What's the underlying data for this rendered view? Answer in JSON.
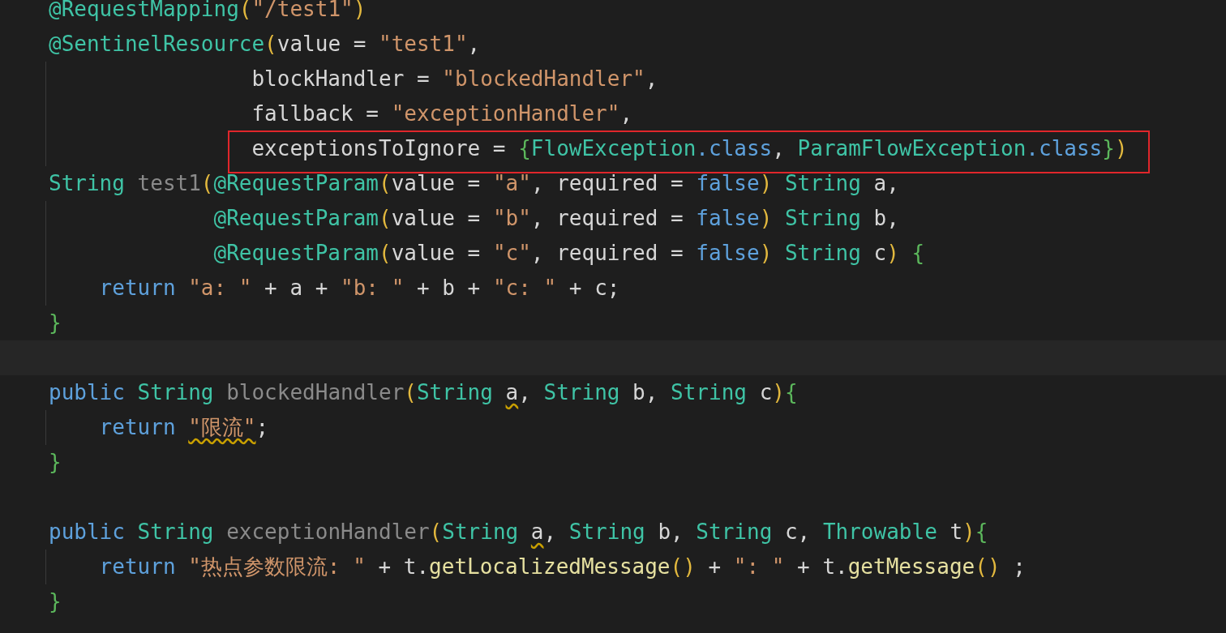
{
  "editor": {
    "lines": [
      {
        "kind": "code",
        "tokens": [
          {
            "kind": "ann",
            "text": "@RequestMapping"
          },
          {
            "kind": "paren",
            "text": "("
          },
          {
            "kind": "str",
            "text": "\"/test1\""
          },
          {
            "kind": "paren",
            "text": ")"
          }
        ]
      },
      {
        "kind": "code",
        "tokens": [
          {
            "kind": "ann",
            "text": "@SentinelResource"
          },
          {
            "kind": "paren",
            "text": "("
          },
          {
            "kind": "plain",
            "text": "value = "
          },
          {
            "kind": "str",
            "text": "\"test1\""
          },
          {
            "kind": "plain",
            "text": ","
          }
        ]
      },
      {
        "kind": "code",
        "guide": true,
        "tokens": [
          {
            "kind": "plain",
            "text": "                blockHandler = "
          },
          {
            "kind": "str",
            "text": "\"blockedHandler\""
          },
          {
            "kind": "plain",
            "text": ","
          }
        ]
      },
      {
        "kind": "code",
        "guide": true,
        "tokens": [
          {
            "kind": "plain",
            "text": "                fallback = "
          },
          {
            "kind": "str",
            "text": "\"exceptionHandler\""
          },
          {
            "kind": "plain",
            "text": ","
          }
        ]
      },
      {
        "kind": "code",
        "guide": true,
        "boxed": true,
        "tokens": [
          {
            "kind": "plain",
            "text": "                exceptionsToIgnore = "
          },
          {
            "kind": "brace",
            "text": "{"
          },
          {
            "kind": "type",
            "text": "FlowException"
          },
          {
            "kind": "kw",
            "text": ".class"
          },
          {
            "kind": "plain",
            "text": ", "
          },
          {
            "kind": "type",
            "text": "ParamFlowException"
          },
          {
            "kind": "kw",
            "text": ".class"
          },
          {
            "kind": "brace",
            "text": "}"
          },
          {
            "kind": "paren",
            "text": ")"
          }
        ]
      },
      {
        "kind": "code",
        "tokens": [
          {
            "kind": "type",
            "text": "String "
          },
          {
            "kind": "decl",
            "text": "test1"
          },
          {
            "kind": "paren",
            "text": "("
          },
          {
            "kind": "ann",
            "text": "@RequestParam"
          },
          {
            "kind": "paren",
            "text": "("
          },
          {
            "kind": "plain",
            "text": "value = "
          },
          {
            "kind": "str",
            "text": "\"a\""
          },
          {
            "kind": "plain",
            "text": ", required = "
          },
          {
            "kind": "kw",
            "text": "false"
          },
          {
            "kind": "paren",
            "text": ")"
          },
          {
            "kind": "type",
            "text": " String "
          },
          {
            "kind": "plain",
            "text": "a,"
          }
        ]
      },
      {
        "kind": "code",
        "guide": true,
        "tokens": [
          {
            "kind": "ann",
            "text": "             @RequestParam"
          },
          {
            "kind": "paren",
            "text": "("
          },
          {
            "kind": "plain",
            "text": "value = "
          },
          {
            "kind": "str",
            "text": "\"b\""
          },
          {
            "kind": "plain",
            "text": ", required = "
          },
          {
            "kind": "kw",
            "text": "false"
          },
          {
            "kind": "paren",
            "text": ")"
          },
          {
            "kind": "type",
            "text": " String "
          },
          {
            "kind": "plain",
            "text": "b,"
          }
        ]
      },
      {
        "kind": "code",
        "guide": true,
        "tokens": [
          {
            "kind": "ann",
            "text": "             @RequestParam"
          },
          {
            "kind": "paren",
            "text": "("
          },
          {
            "kind": "plain",
            "text": "value = "
          },
          {
            "kind": "str",
            "text": "\"c\""
          },
          {
            "kind": "plain",
            "text": ", required = "
          },
          {
            "kind": "kw",
            "text": "false"
          },
          {
            "kind": "paren",
            "text": ")"
          },
          {
            "kind": "type",
            "text": " String "
          },
          {
            "kind": "plain",
            "text": "c"
          },
          {
            "kind": "paren",
            "text": ") "
          },
          {
            "kind": "brace",
            "text": "{"
          }
        ]
      },
      {
        "kind": "code",
        "guide": true,
        "tokens": [
          {
            "kind": "kw",
            "text": "    return "
          },
          {
            "kind": "str",
            "text": "\"a: \""
          },
          {
            "kind": "plain",
            "text": " + a + "
          },
          {
            "kind": "str",
            "text": "\"b: \""
          },
          {
            "kind": "plain",
            "text": " + b + "
          },
          {
            "kind": "str",
            "text": "\"c: \""
          },
          {
            "kind": "plain",
            "text": " + c;"
          }
        ]
      },
      {
        "kind": "code",
        "tokens": [
          {
            "kind": "brace",
            "text": "}"
          }
        ]
      },
      {
        "kind": "blank",
        "current": true
      },
      {
        "kind": "code",
        "tokens": [
          {
            "kind": "kw",
            "text": "public "
          },
          {
            "kind": "type",
            "text": "String "
          },
          {
            "kind": "decl",
            "text": "blockedHandler"
          },
          {
            "kind": "paren",
            "text": "("
          },
          {
            "kind": "type",
            "text": "String "
          },
          {
            "kind": "warn",
            "text": "a"
          },
          {
            "kind": "plain",
            "text": ", "
          },
          {
            "kind": "type",
            "text": "String "
          },
          {
            "kind": "plain",
            "text": "b, "
          },
          {
            "kind": "type",
            "text": "String "
          },
          {
            "kind": "plain",
            "text": "c"
          },
          {
            "kind": "paren",
            "text": ")"
          },
          {
            "kind": "brace",
            "text": "{"
          }
        ]
      },
      {
        "kind": "code",
        "guide": true,
        "tokens": [
          {
            "kind": "kw",
            "text": "    return "
          },
          {
            "kind": "warnstr",
            "text": "\"限流\""
          },
          {
            "kind": "plain",
            "text": ";"
          }
        ]
      },
      {
        "kind": "code",
        "tokens": [
          {
            "kind": "brace",
            "text": "}"
          }
        ]
      },
      {
        "kind": "blank"
      },
      {
        "kind": "code",
        "tokens": [
          {
            "kind": "kw",
            "text": "public "
          },
          {
            "kind": "type",
            "text": "String "
          },
          {
            "kind": "decl",
            "text": "exceptionHandler"
          },
          {
            "kind": "paren",
            "text": "("
          },
          {
            "kind": "type",
            "text": "String "
          },
          {
            "kind": "warn",
            "text": "a"
          },
          {
            "kind": "plain",
            "text": ", "
          },
          {
            "kind": "type",
            "text": "String "
          },
          {
            "kind": "plain",
            "text": "b, "
          },
          {
            "kind": "type",
            "text": "String "
          },
          {
            "kind": "plain",
            "text": "c, "
          },
          {
            "kind": "type",
            "text": "Throwable "
          },
          {
            "kind": "plain",
            "text": "t"
          },
          {
            "kind": "paren",
            "text": ")"
          },
          {
            "kind": "brace",
            "text": "{"
          }
        ]
      },
      {
        "kind": "code",
        "guide": true,
        "tokens": [
          {
            "kind": "kw",
            "text": "    return "
          },
          {
            "kind": "str",
            "text": "\"热点参数限流: \""
          },
          {
            "kind": "plain",
            "text": " + t."
          },
          {
            "kind": "call",
            "text": "getLocalizedMessage"
          },
          {
            "kind": "paren",
            "text": "()"
          },
          {
            "kind": "plain",
            "text": " + "
          },
          {
            "kind": "str",
            "text": "\": \""
          },
          {
            "kind": "plain",
            "text": " + t."
          },
          {
            "kind": "call",
            "text": "getMessage"
          },
          {
            "kind": "paren",
            "text": "()"
          },
          {
            "kind": "plain",
            "text": " ;"
          }
        ]
      },
      {
        "kind": "code",
        "tokens": [
          {
            "kind": "brace",
            "text": "}"
          }
        ]
      }
    ]
  }
}
